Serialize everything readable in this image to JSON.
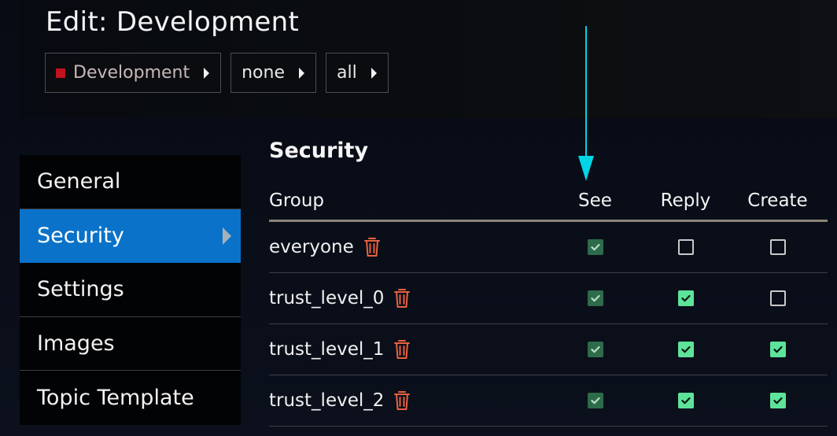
{
  "header": {
    "title": "Edit: Development",
    "breadcrumbs": [
      {
        "label": "Development",
        "color": "#c1121f"
      },
      {
        "label": "none"
      },
      {
        "label": "all"
      }
    ]
  },
  "sidebar": {
    "items": [
      {
        "label": "General",
        "active": false
      },
      {
        "label": "Security",
        "active": true
      },
      {
        "label": "Settings",
        "active": false
      },
      {
        "label": "Images",
        "active": false
      },
      {
        "label": "Topic Template",
        "active": false
      }
    ]
  },
  "security": {
    "title": "Security",
    "columns": {
      "group": "Group",
      "see": "See",
      "reply": "Reply",
      "create": "Create"
    },
    "rows": [
      {
        "group": "everyone",
        "see": "checked-disabled",
        "reply": "unchecked",
        "create": "unchecked"
      },
      {
        "group": "trust_level_0",
        "see": "checked-disabled",
        "reply": "checked",
        "create": "unchecked"
      },
      {
        "group": "trust_level_1",
        "see": "checked-disabled",
        "reply": "checked",
        "create": "checked"
      },
      {
        "group": "trust_level_2",
        "see": "checked-disabled",
        "reply": "checked",
        "create": "checked"
      }
    ]
  },
  "colors": {
    "accent": "#0a72c8",
    "trash": "#e8623f",
    "check_on": "#5ee39a",
    "check_dim": "#2e6b4a",
    "annotation_arrow": "#00d5e6"
  },
  "icons": {
    "delete": "trash-icon",
    "breadcrumb_caret": "caret-right-icon",
    "active_nav": "caret-right-icon",
    "annotation": "arrow-down-icon"
  }
}
